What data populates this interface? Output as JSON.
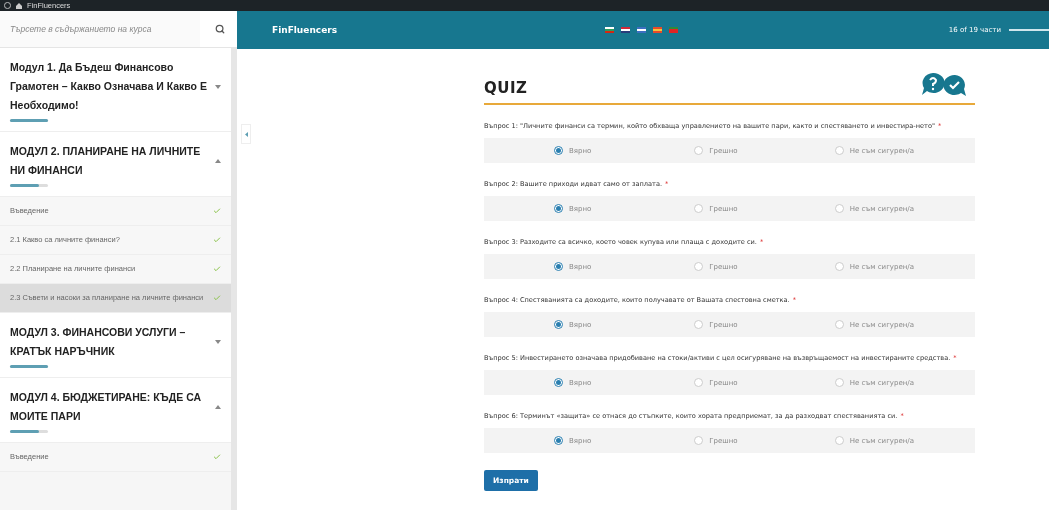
{
  "admin_bar": {
    "site_name": "FinFluencers"
  },
  "search": {
    "placeholder": "Търсете в съдържанието на курса"
  },
  "header": {
    "course_title": "FinFluencers",
    "progress_text": "16 of 19 части",
    "level": 0.84
  },
  "sidebar": {
    "modules": [
      {
        "title": "Модул 1. Да Бъдеш Финансово Грамотен – Какво Означава И Какво Е Необходимо!",
        "expanded": false,
        "level": 1
      },
      {
        "title": "МОДУЛ 2. ПЛАНИРАНЕ НА ЛИЧНИТЕ НИ ФИНАНСИ",
        "expanded": true,
        "level": 0.75,
        "lessons": [
          {
            "title": "Въведение",
            "completed": true,
            "selected": false
          },
          {
            "title": "2.1 Какво са личните финанси?",
            "completed": true,
            "selected": false
          },
          {
            "title": "2.2 Планиране на личните финанси",
            "completed": true,
            "selected": false
          },
          {
            "title": "2.3 Съвети и насоки за планиране на личните финанси",
            "completed": true,
            "selected": true
          }
        ]
      },
      {
        "title": "МОДУЛ 3. ФИНАНСОВИ УСЛУГИ – КРАТЪК НАРЪЧНИК",
        "expanded": false,
        "level": 1
      },
      {
        "title": "МОДУЛ 4. БЮДЖЕТИРАНЕ: КЪДЕ СА МОИТЕ ПАРИ",
        "expanded": true,
        "level": 0.75,
        "lessons": [
          {
            "title": "Въведение",
            "completed": true,
            "selected": false
          }
        ]
      }
    ]
  },
  "quiz": {
    "title": "QUIZ",
    "questions": [
      {
        "text": "Въпрос 1: \"Личните финанси са термин, който обхваща управлението на вашите пари, както и спестяването и инвестира-нето\"",
        "required_mark": "*",
        "options": [
          {
            "label": "Вярно",
            "selected": true
          },
          {
            "label": "Грешно",
            "selected": false
          },
          {
            "label": "Не съм сигурен/а",
            "selected": false
          }
        ]
      },
      {
        "text": "Въпрос 2: Вашите приходи идват само от заплата.",
        "required_mark": "*",
        "options": [
          {
            "label": "Вярно",
            "selected": true
          },
          {
            "label": "Грешно",
            "selected": false
          },
          {
            "label": "Не съм сигурен/а",
            "selected": false
          }
        ]
      },
      {
        "text": "Въпрос 3: Разходите са всичко, което човек купува или плаща с доходите си.",
        "required_mark": "*",
        "options": [
          {
            "label": "Вярно",
            "selected": true
          },
          {
            "label": "Грешно",
            "selected": false
          },
          {
            "label": "Не съм сигурен/а",
            "selected": false
          }
        ]
      },
      {
        "text": "Въпрос 4: Спестяванията са доходите, които получавате от Вашата спестовна сметка.",
        "required_mark": "*",
        "options": [
          {
            "label": "Вярно",
            "selected": true
          },
          {
            "label": "Грешно",
            "selected": false
          },
          {
            "label": "Не съм сигурен/а",
            "selected": false
          }
        ]
      },
      {
        "text": "Въпрос 5: Инвестирането означава придобиване на стоки/активи с цел осигуряване на възвръщаемост на инвестираните средства.",
        "required_mark": "*",
        "options": [
          {
            "label": "Вярно",
            "selected": true
          },
          {
            "label": "Грешно",
            "selected": false
          },
          {
            "label": "Не съм сигурен/а",
            "selected": false
          }
        ]
      },
      {
        "text": "Въпрос 6: Терминът «защита» се отнася до стъпките, които хората предприемат, за да разходват спестяванията си.",
        "required_mark": "*",
        "options": [
          {
            "label": "Вярно",
            "selected": true
          },
          {
            "label": "Грешно",
            "selected": false
          },
          {
            "label": "Не съм сигурен/а",
            "selected": false
          }
        ]
      }
    ],
    "submit": "Изпрати"
  }
}
